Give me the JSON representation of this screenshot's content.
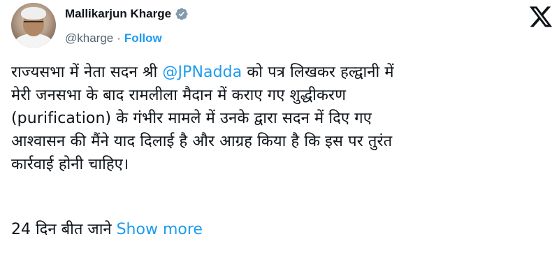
{
  "author": {
    "name": "Mallikarjun Kharge",
    "handle": "@kharge",
    "separator": "·",
    "follow_label": "Follow"
  },
  "tweet": {
    "lines": [
      {
        "before": "राज्यसभा में नेता सदन श्री ",
        "mention": "@JPNadda",
        "after": " को पत्र लिखकर हल्द्वानी में"
      },
      {
        "text": "मेरी जनसभा के बाद रामलीला मैदान में कराए गए शुद्धीकरण"
      },
      {
        "text": "(purification) के गंभीर मामले में उनके द्वारा सदन में दिए गए"
      },
      {
        "text": "आश्वासन की मैंने याद दिलाई है और आग्रह किया है कि इस पर तुरंत"
      },
      {
        "text": "कार्रवाई होनी चाहिए।"
      }
    ],
    "truncated_text": "24 दिन बीत जाने ",
    "show_more_label": "Show more"
  },
  "icons": {
    "verified": "verified-badge-icon",
    "x_logo": "x-logo-icon"
  },
  "colors": {
    "link": "#1d9bf0",
    "text": "#0f1419",
    "secondary": "#536471"
  }
}
